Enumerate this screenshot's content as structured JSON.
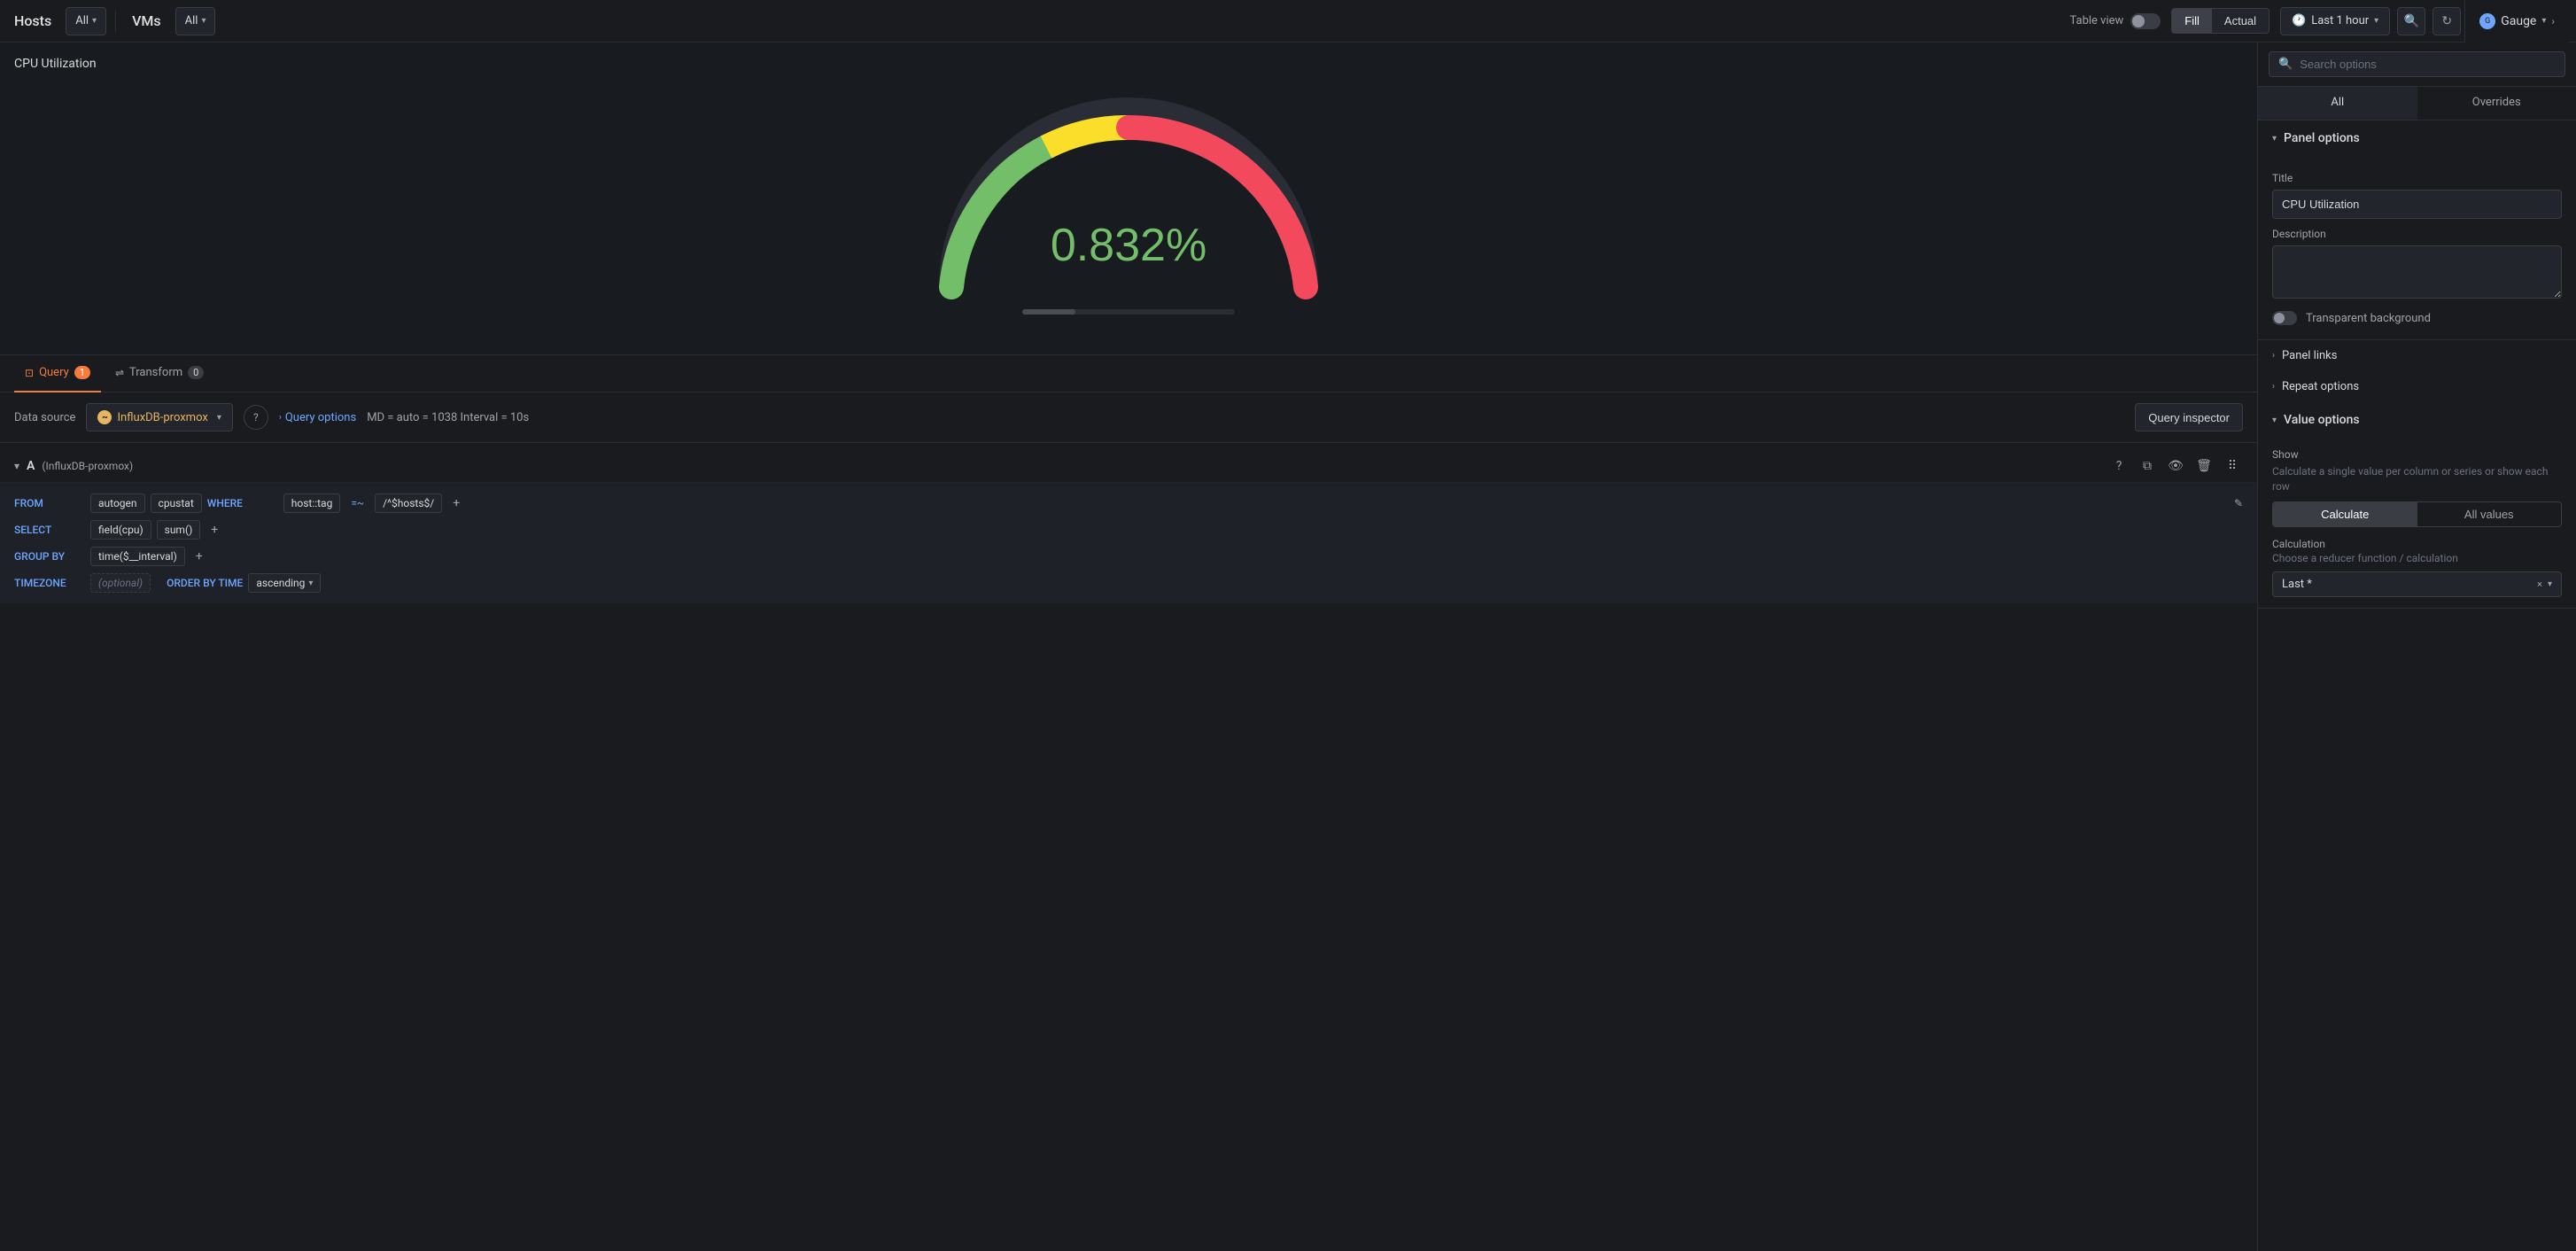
{
  "topNav": {
    "hostsLabel": "Hosts",
    "hostsDropdown": "All",
    "vmsLabel": "VMs",
    "vmsDropdown": "All",
    "tableViewLabel": "Table view",
    "fillBtn": "Fill",
    "actualBtn": "Actual",
    "timeBtn": "Last 1 hour",
    "gaugeLabel": "Gauge",
    "searchPlaceholder": "Search options"
  },
  "chart": {
    "title": "CPU Utilization",
    "value": "0.832%"
  },
  "queryTabs": [
    {
      "label": "Query",
      "badge": "1",
      "active": true
    },
    {
      "label": "Transform",
      "badge": "0",
      "active": false
    }
  ],
  "datasource": {
    "label": "Data source",
    "name": "InfluxDB-proxmox"
  },
  "queryOptions": {
    "label": "Query options",
    "meta": "MD = auto = 1038   Interval = 10s"
  },
  "queryInspector": {
    "label": "Query inspector"
  },
  "queryBuilder": {
    "letter": "A",
    "sourceName": "(InfluxDB-proxmox)",
    "fields": {
      "from": {
        "keyword": "FROM",
        "values": [
          "autogen",
          "cpustat"
        ]
      },
      "where": {
        "keyword": "WHERE",
        "operator": "=~",
        "tag": "host::tag",
        "value": "/^$hosts$/",
        "addBtn": "+"
      },
      "select": {
        "keyword": "SELECT",
        "values": [
          "field(cpu)",
          "sum()"
        ],
        "addBtn": "+"
      },
      "groupBy": {
        "keyword": "GROUP BY",
        "values": [
          "time($__interval)"
        ],
        "addBtn": "+"
      },
      "timezone": {
        "keyword": "TIMEZONE",
        "placeholder": "(optional)"
      },
      "orderByTime": {
        "keyword": "ORDER BY TIME",
        "value": "ascending"
      }
    }
  },
  "rightPanel": {
    "search": {
      "placeholder": "Search options"
    },
    "tabs": [
      {
        "label": "All",
        "active": true
      },
      {
        "label": "Overrides",
        "active": false
      }
    ],
    "panelOptions": {
      "title": "Panel options",
      "fields": {
        "title": {
          "label": "Title",
          "value": "CPU Utilization"
        },
        "description": {
          "label": "Description",
          "value": ""
        },
        "transparentBg": {
          "label": "Transparent background"
        }
      }
    },
    "panelLinks": {
      "title": "Panel links"
    },
    "repeatOptions": {
      "title": "Repeat options"
    },
    "valueOptions": {
      "title": "Value options",
      "showLabel": "Show",
      "showDesc": "Calculate a single value per column or series or show each row",
      "showBtns": [
        {
          "label": "Calculate",
          "active": true
        },
        {
          "label": "All values",
          "active": false
        }
      ],
      "calcLabel": "Calculation",
      "calcDesc": "Choose a reducer function / calculation",
      "calcValue": "Last *",
      "clearBtn": "×",
      "chevron": "▾"
    }
  }
}
